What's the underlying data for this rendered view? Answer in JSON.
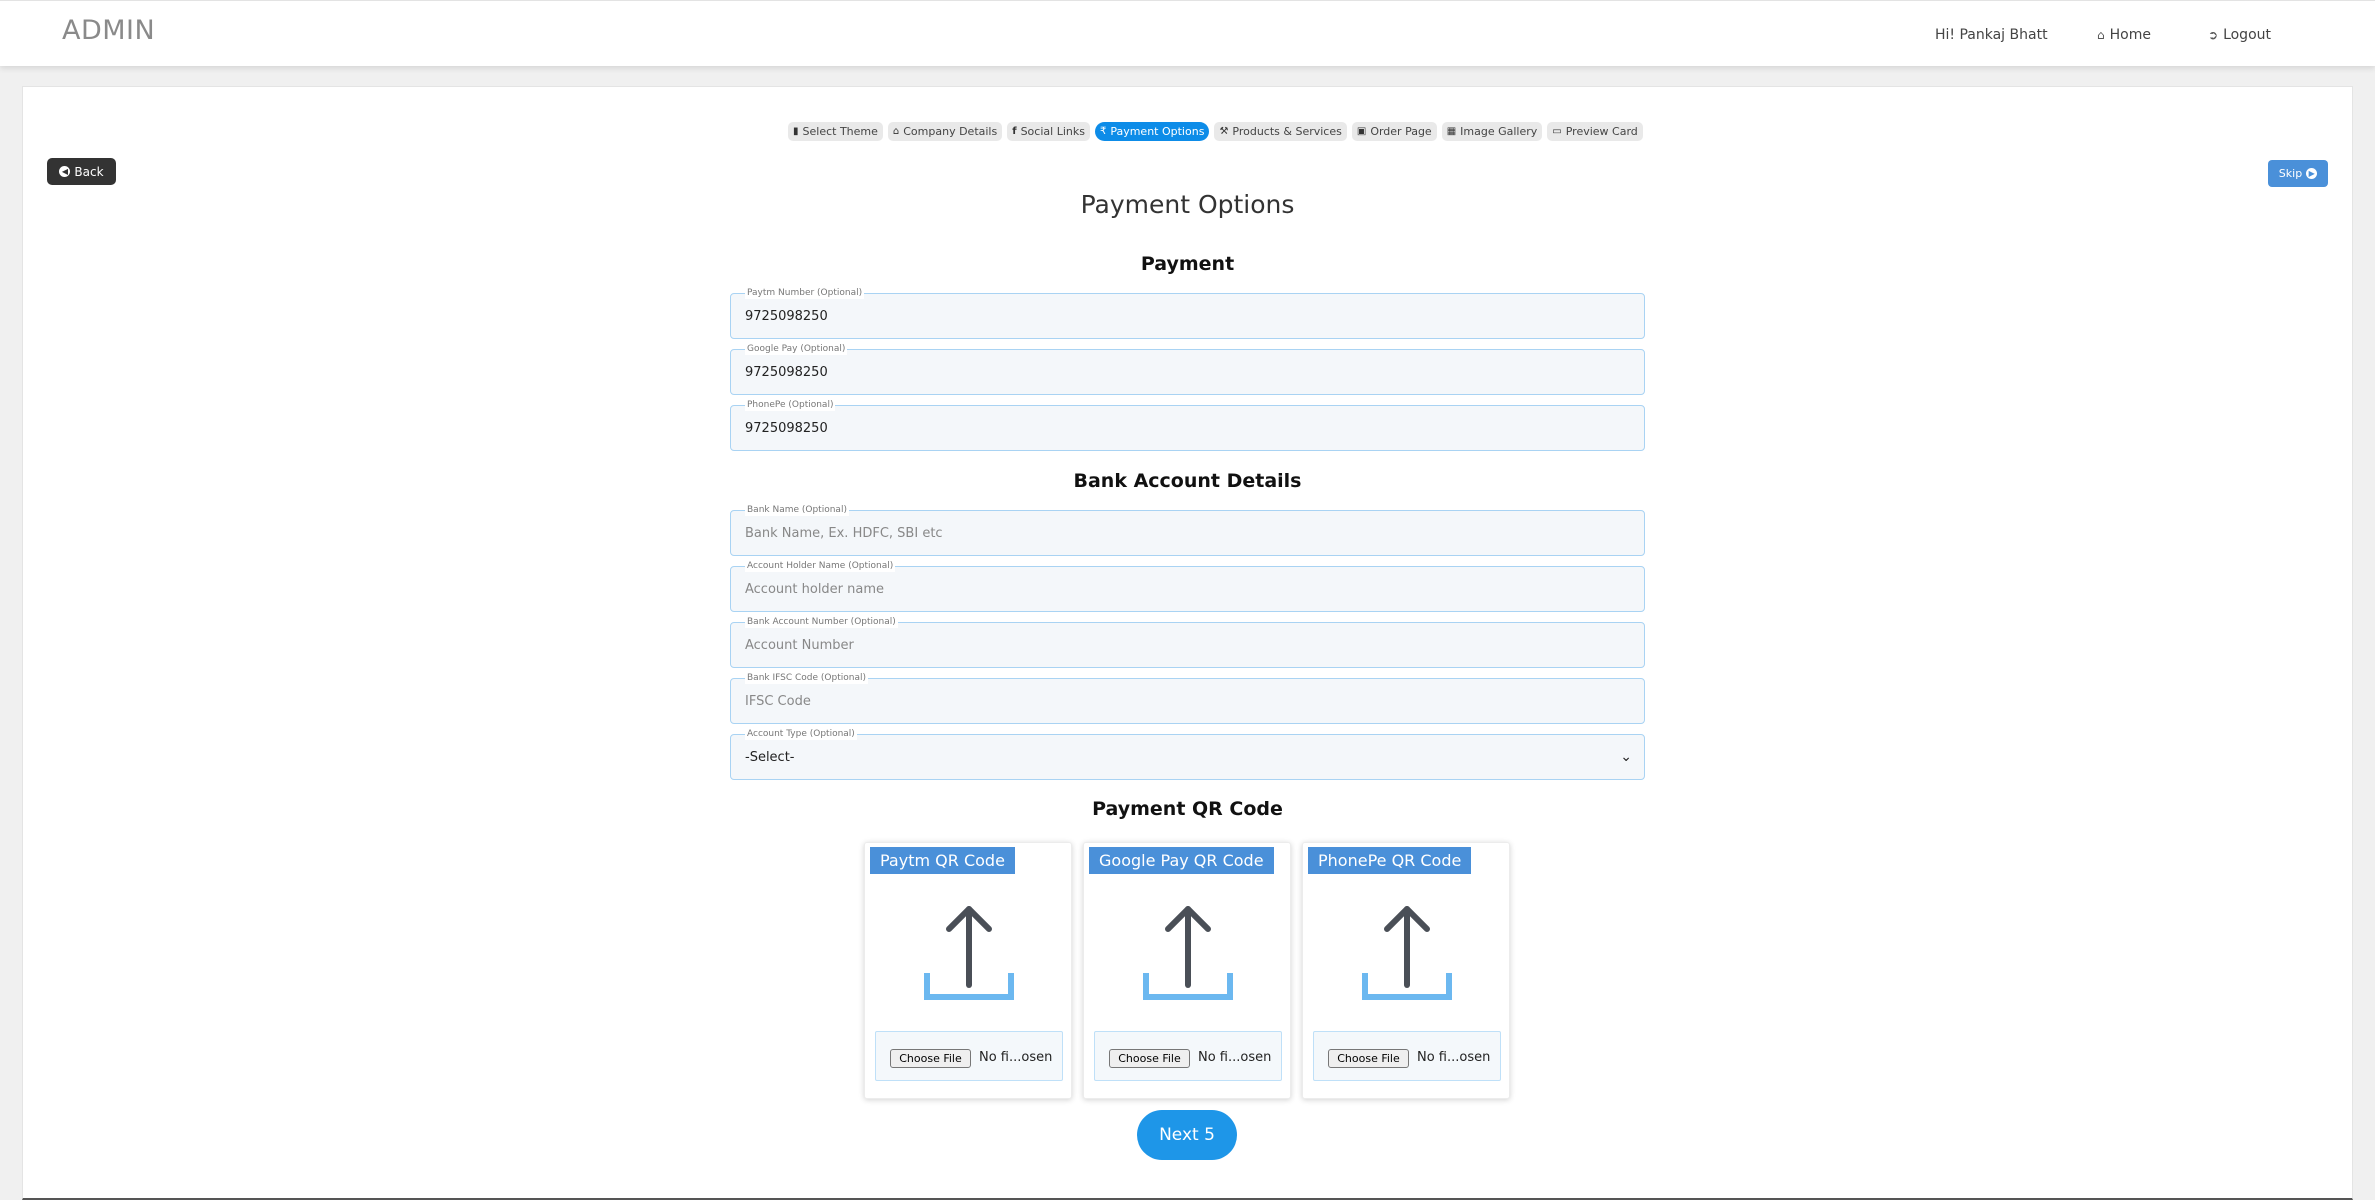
{
  "header": {
    "brand": "ADMIN",
    "greeting": "Hi! Pankaj Bhatt",
    "home": "Home",
    "logout": "Logout"
  },
  "steps": [
    {
      "label": "Select Theme",
      "icon": "palette-icon",
      "active": false
    },
    {
      "label": "Company Details",
      "icon": "bank-icon",
      "active": false
    },
    {
      "label": "Social Links",
      "icon": "facebook-icon",
      "active": false
    },
    {
      "label": "Payment Options",
      "icon": "rupee-icon",
      "active": true
    },
    {
      "label": "Products & Services",
      "icon": "gavel-icon",
      "active": false
    },
    {
      "label": "Order Page",
      "icon": "credit-card-icon",
      "active": false
    },
    {
      "label": "Image Gallery",
      "icon": "image-icon",
      "active": false
    },
    {
      "label": "Preview Card",
      "icon": "laptop-icon",
      "active": false
    }
  ],
  "buttons": {
    "back": "Back",
    "skip": "Skip",
    "next": "Next 5"
  },
  "page_title": "Payment Options",
  "sections": {
    "payment": "Payment",
    "bank": "Bank Account Details",
    "qr": "Payment QR Code"
  },
  "payment_fields": {
    "paytm": {
      "label": "Paytm Number (Optional)",
      "value": "9725098250"
    },
    "gpay": {
      "label": "Google Pay (Optional)",
      "value": "9725098250"
    },
    "phonepe": {
      "label": "PhonePe (Optional)",
      "value": "9725098250"
    }
  },
  "bank_fields": {
    "bank_name": {
      "label": "Bank Name (Optional)",
      "placeholder": "Bank Name, Ex. HDFC, SBI etc"
    },
    "holder": {
      "label": "Account Holder Name (Optional)",
      "placeholder": "Account holder name"
    },
    "account_number": {
      "label": "Bank Account Number (Optional)",
      "placeholder": "Account Number"
    },
    "ifsc": {
      "label": "Bank IFSC Code (Optional)",
      "placeholder": "IFSC Code"
    },
    "account_type": {
      "label": "Account Type (Optional)",
      "value": "-Select-"
    }
  },
  "qr_cards": {
    "paytm": {
      "label": "Paytm QR Code",
      "choose": "Choose File",
      "status": "No fi...osen"
    },
    "gpay": {
      "label": "Google Pay QR Code",
      "choose": "Choose File",
      "status": "No fi...osen"
    },
    "phonepe": {
      "label": "PhonePe QR Code",
      "choose": "Choose File",
      "status": "No fi...osen"
    }
  },
  "colors": {
    "accent": "#0d8ce8",
    "label_blue": "#4a90d9",
    "next_button": "#1e96e8",
    "upload_tray": "#6cb8f0",
    "upload_arrow": "#4a4f57"
  }
}
